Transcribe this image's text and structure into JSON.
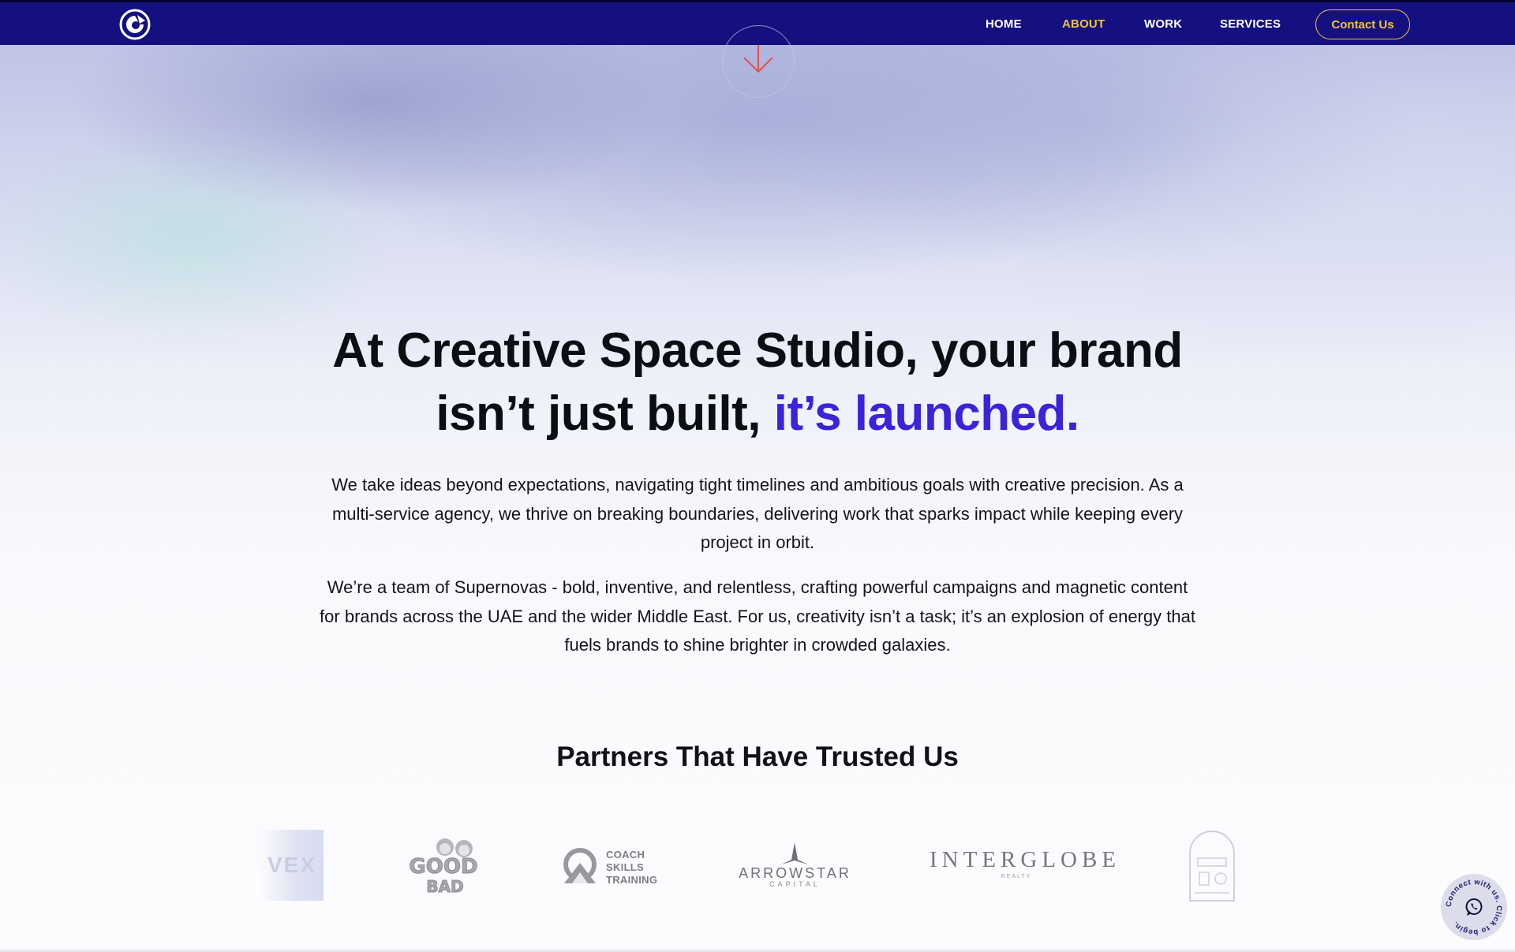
{
  "nav": {
    "logo_icon": "astronaut-helmet-icon",
    "items": [
      {
        "label": "HOME",
        "active": false
      },
      {
        "label": "ABOUT",
        "active": true
      },
      {
        "label": "WORK",
        "active": false
      },
      {
        "label": "SERVICES",
        "active": false
      }
    ],
    "contact_label": "Contact Us"
  },
  "hero": {
    "scroll_icon": "arrow-down-icon",
    "headline_line1": "At Creative Space Studio, your brand",
    "headline_line2": "isn’t just built,",
    "headline_accent": "it’s launched.",
    "paragraph1": "We take ideas beyond expectations, navigating tight timelines and ambitious goals with creative precision. As a multi-service agency, we thrive on breaking boundaries, delivering work that sparks impact while keeping every project in orbit.",
    "paragraph2": "We’re a team of Supernovas - bold, inventive, and relentless, crafting powerful campaigns and magnetic content for brands across the UAE and the wider Middle East. For us, creativity isn’t a task; it’s an explosion of energy that fuels brands to shine brighter in crowded galaxies."
  },
  "partners": {
    "title": "Partners That Have Trusted Us",
    "logos": [
      {
        "name": "VEX",
        "text": "VEX"
      },
      {
        "name": "Have a Good Bad Day",
        "line1": "GOOD",
        "line2": "BAD"
      },
      {
        "name": "Coach Skills Training",
        "lines": [
          "COACH",
          "SKILLS",
          "TRAINING"
        ]
      },
      {
        "name": "Arrowstar Capital",
        "title": "ARROWSTAR",
        "subtitle": "CAPITAL"
      },
      {
        "name": "Interglobe Realty",
        "title": "INTERGLOBE",
        "subtitle": "REALTY"
      },
      {
        "name": "Cafe emblem"
      }
    ]
  },
  "whatsapp": {
    "ring_text": "Connect with us. Click to begin. ",
    "icon": "whatsapp-icon"
  },
  "colors": {
    "nav_bg": "#14107f",
    "nav_active": "#f6c23e",
    "accent": "#3c22d8",
    "scroll_arrow": "#e0524a"
  }
}
